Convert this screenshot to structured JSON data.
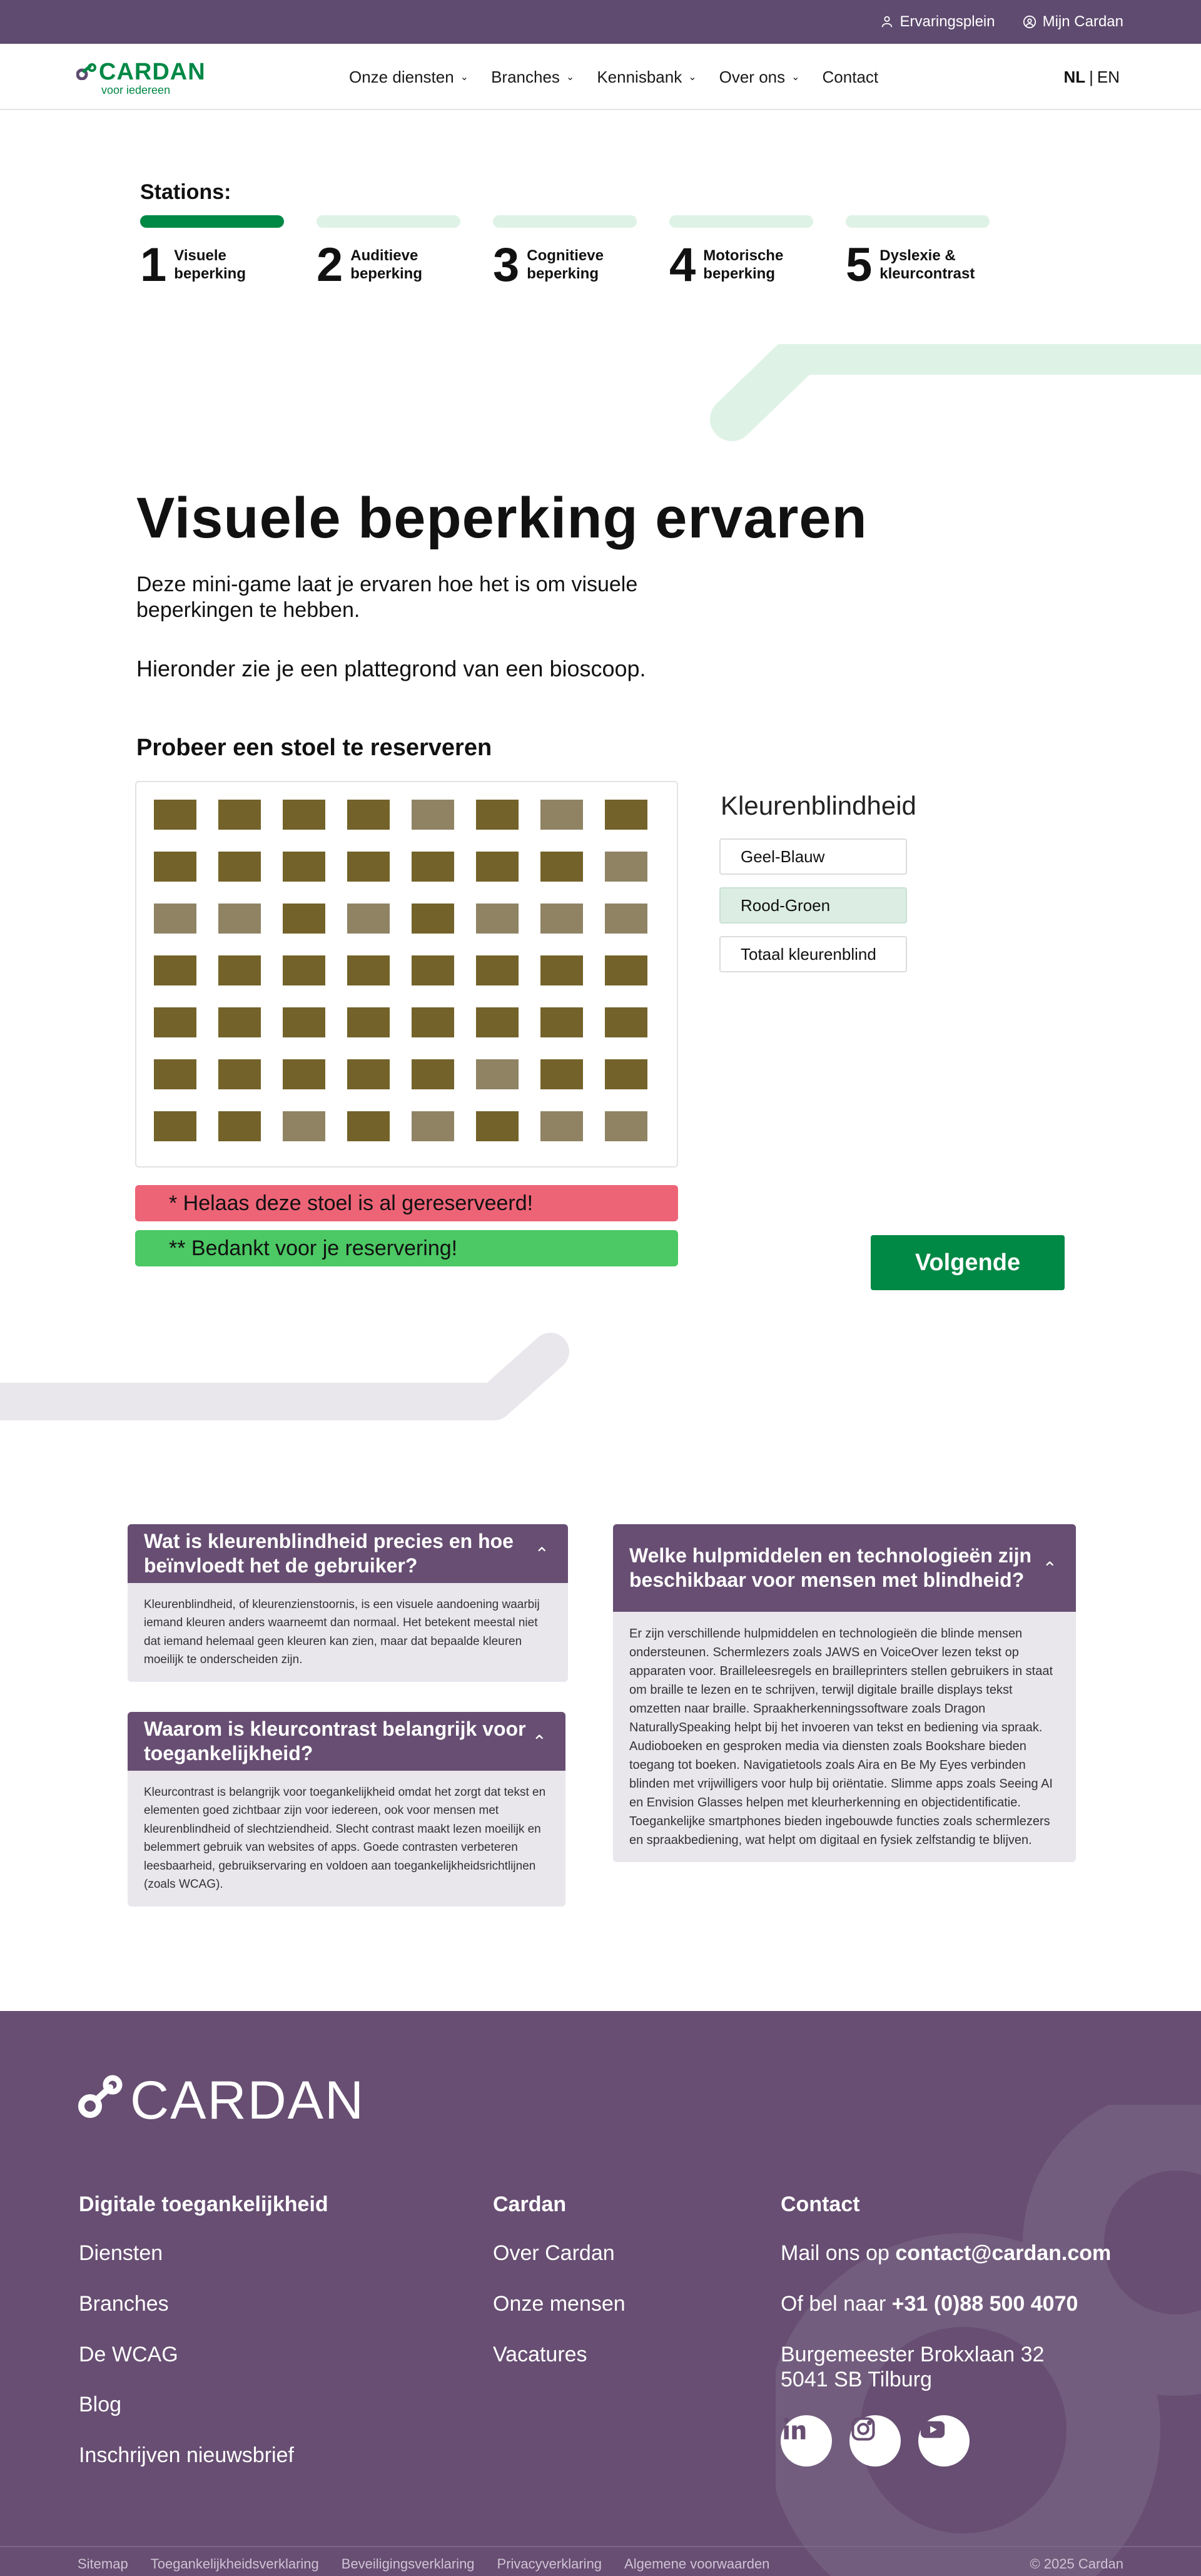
{
  "topbar": {
    "experience": "Ervaringsplein",
    "account": "Mijn Cardan"
  },
  "header": {
    "logo_text": "CARDAN",
    "logo_sub": "voor iedereen",
    "nav": [
      "Onze diensten",
      "Branches",
      "Kennisbank",
      "Over ons",
      "Contact"
    ],
    "lang_active": "NL",
    "lang_sep": "|",
    "lang_other": "EN"
  },
  "stations": {
    "title": "Stations:",
    "items": [
      {
        "num": "1",
        "label": "Visuele\nbeperking",
        "active": true
      },
      {
        "num": "2",
        "label": "Auditieve\nbeperking",
        "active": false
      },
      {
        "num": "3",
        "label": "Cognitieve\nbeperking",
        "active": false
      },
      {
        "num": "4",
        "label": "Motorische\nbeperking",
        "active": false
      },
      {
        "num": "5",
        "label": "Dyslexie &\nkleurcontrast",
        "active": false
      }
    ]
  },
  "main": {
    "title": "Visuele beperking ervaren",
    "intro": "Deze mini-game laat je ervaren hoe het is om visuele beperkingen te hebben.",
    "intro2": "Hieronder zie je een plattegrond van een bioscoop.",
    "game_title": "Probeer een stoel te reserveren"
  },
  "seats": [
    [
      "dark",
      "dark",
      "dark",
      "dark",
      "light",
      "dark",
      "light",
      "dark"
    ],
    [
      "dark",
      "dark",
      "dark",
      "dark",
      "dark",
      "dark",
      "dark",
      "light"
    ],
    [
      "light",
      "light",
      "dark",
      "light",
      "dark",
      "light",
      "light",
      "light"
    ],
    [
      "dark",
      "dark",
      "dark",
      "dark",
      "dark",
      "dark",
      "dark",
      "dark"
    ],
    [
      "dark",
      "dark",
      "dark",
      "dark",
      "dark",
      "dark",
      "dark",
      "dark"
    ],
    [
      "dark",
      "dark",
      "dark",
      "dark",
      "dark",
      "light",
      "dark",
      "dark"
    ],
    [
      "dark",
      "dark",
      "light",
      "dark",
      "light",
      "dark",
      "light",
      "light"
    ]
  ],
  "colors": {
    "seat_dark": "#736229",
    "seat_light": "#8f8364",
    "brand_green": "#008845",
    "brand_purple": "#674e72",
    "error": "#ee6477",
    "success": "#4cc864"
  },
  "colorblind": {
    "title": "Kleurenblindheid",
    "options": [
      "Geel-Blauw",
      "Rood-Groen",
      "Totaal kleurenblind"
    ],
    "selected": "Rood-Groen"
  },
  "messages": {
    "error": "* Helaas deze stoel is al gereserveerd!",
    "success": "** Bedankt voor je reservering!"
  },
  "next_label": "Volgende",
  "faq": [
    {
      "q": "Wat is kleurenblindheid precies en hoe beïnvloedt het de gebruiker?",
      "a": "Kleurenblindheid, of kleurenzienstoornis, is een visuele aandoening waarbij iemand kleuren anders waarneemt dan normaal. Het betekent meestal niet dat iemand helemaal geen kleuren kan zien, maar dat bepaalde kleuren moeilijk te onderscheiden zijn."
    },
    {
      "q": "Waarom is kleurcontrast belangrijk voor toegankelijkheid?",
      "a": "Kleurcontrast is belangrijk voor toegankelijkheid omdat het zorgt dat tekst en elementen goed zichtbaar zijn voor iedereen, ook voor mensen met kleurenblindheid of slechtziendheid. Slecht contrast maakt lezen moeilijk en belemmert gebruik van websites of apps. Goede contrasten verbeteren leesbaarheid, gebruikservaring en voldoen aan toegankelijkheidsrichtlijnen (zoals WCAG)."
    },
    {
      "q": "Welke hulpmiddelen en technologieën zijn beschikbaar voor mensen met blindheid?",
      "a": "Er zijn verschillende hulpmiddelen en technologieën die blinde mensen ondersteunen. Schermlezers zoals JAWS en VoiceOver lezen tekst op apparaten voor. Brailleleesregels en brailleprinters stellen gebruikers in staat om braille te lezen en te schrijven, terwijl digitale braille displays tekst omzetten naar braille. Spraakherkenningssoftware zoals Dragon NaturallySpeaking helpt bij het invoeren van tekst en bediening via spraak. Audioboeken en gesproken media via diensten zoals Bookshare bieden toegang tot boeken. Navigatietools zoals Aira en Be My Eyes verbinden blinden met vrijwilligers voor hulp bij oriëntatie. Slimme apps zoals Seeing AI en Envision Glasses helpen met kleurherkenning en objectidentificatie. Toegankelijke smartphones bieden ingebouwde functies zoals schermlezers en spraakbediening, wat helpt om digitaal en fysiek zelfstandig te blijven."
    }
  ],
  "footer": {
    "logo_text": "CARDAN",
    "col1": {
      "title": "Digitale toegankelijkheid",
      "links": [
        "Diensten",
        "Branches",
        "De WCAG",
        "Blog",
        "Inschrijven nieuwsbrief"
      ]
    },
    "col2": {
      "title": "Cardan",
      "links": [
        "Over Cardan",
        "Onze mensen",
        "Vacatures"
      ]
    },
    "col3": {
      "title": "Contact",
      "mail_prefix": "Mail ons op ",
      "mail": "contact@cardan.com",
      "phone_prefix": "Of bel naar ",
      "phone": "+31 (0)88 500 4070",
      "address1": "Burgemeester Brokxlaan 32",
      "address2": "5041 SB Tilburg",
      "socials": [
        "linkedin-icon",
        "instagram-icon",
        "youtube-icon"
      ]
    },
    "sublinks": [
      "Sitemap",
      "Toegankelijkheidsverklaring",
      "Beveiligingsverklaring",
      "Privacyverklaring",
      "Algemene voorwaarden"
    ],
    "copyright": "© 2025 Cardan"
  }
}
